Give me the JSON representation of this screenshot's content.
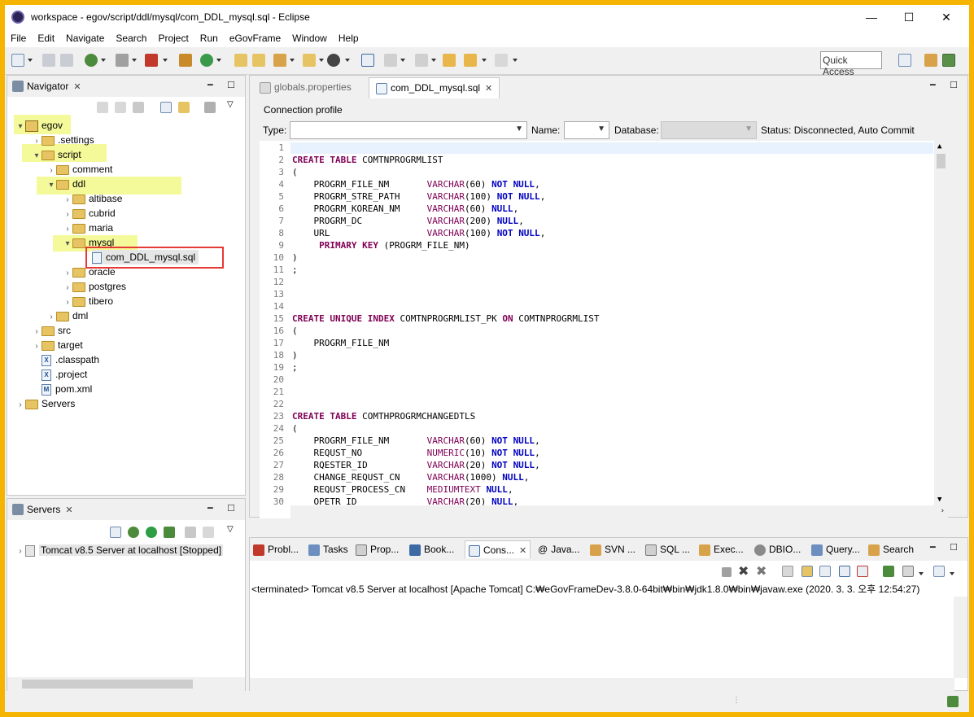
{
  "window": {
    "title": "workspace - egov/script/ddl/mysql/com_DDL_mysql.sql - Eclipse",
    "minimize": "—",
    "maximize": "☐",
    "close": "✕"
  },
  "menu": [
    "File",
    "Edit",
    "Navigate",
    "Search",
    "Project",
    "Run",
    "eGovFrame",
    "Window",
    "Help"
  ],
  "toolbar": {
    "quick_access": "Quick Access"
  },
  "navigator": {
    "title": "Navigator",
    "tree": [
      {
        "label": "egov",
        "twisty": "▾"
      },
      {
        "label": ".settings",
        "twisty": "›"
      },
      {
        "label": "script",
        "twisty": "▾"
      },
      {
        "label": "comment",
        "twisty": "›"
      },
      {
        "label": "ddl",
        "twisty": "▾"
      },
      {
        "label": "altibase",
        "twisty": "›"
      },
      {
        "label": "cubrid",
        "twisty": "›"
      },
      {
        "label": "maria",
        "twisty": "›"
      },
      {
        "label": "mysql",
        "twisty": "▾"
      },
      {
        "label": "com_DDL_mysql.sql",
        "twisty": ""
      },
      {
        "label": "oracle",
        "twisty": "›"
      },
      {
        "label": "postgres",
        "twisty": "›"
      },
      {
        "label": "tibero",
        "twisty": "›"
      },
      {
        "label": "dml",
        "twisty": "›"
      },
      {
        "label": "src",
        "twisty": "›"
      },
      {
        "label": "target",
        "twisty": "›"
      },
      {
        "label": ".classpath",
        "twisty": ""
      },
      {
        "label": ".project",
        "twisty": ""
      },
      {
        "label": "pom.xml",
        "twisty": ""
      },
      {
        "label": "Servers",
        "twisty": "›"
      }
    ]
  },
  "servers_view": {
    "title": "Servers",
    "item": "Tomcat v8.5 Server at localhost  [Stopped]"
  },
  "editor": {
    "tabs": [
      {
        "label": "globals.properties"
      },
      {
        "label": "com_DDL_mysql.sql"
      }
    ],
    "connection_profile": {
      "group_label": "Connection profile",
      "type_label": "Type:",
      "name_label": "Name:",
      "database_label": "Database:",
      "status": "Status: Disconnected, Auto Commit"
    },
    "lines": [
      "",
      "CREATE TABLE COMTNPROGRMLIST",
      "(",
      "    PROGRM_FILE_NM       VARCHAR(60) NOT NULL,",
      "    PROGRM_STRE_PATH     VARCHAR(100) NOT NULL,",
      "    PROGRM_KOREAN_NM     VARCHAR(60) NULL,",
      "    PROGRM_DC            VARCHAR(200) NULL,",
      "    URL                  VARCHAR(100) NOT NULL,",
      "     PRIMARY KEY (PROGRM_FILE_NM)",
      ")",
      ";",
      "",
      "",
      "",
      "CREATE UNIQUE INDEX COMTNPROGRMLIST_PK ON COMTNPROGRMLIST",
      "(",
      "    PROGRM_FILE_NM",
      ")",
      ";",
      "",
      "",
      "",
      "CREATE TABLE COMTHPROGRMCHANGEDTLS",
      "(",
      "    PROGRM_FILE_NM       VARCHAR(60) NOT NULL,",
      "    REQUST_NO            NUMERIC(10) NOT NULL,",
      "    RQESTER_ID           VARCHAR(20) NOT NULL,",
      "    CHANGE_REQUST_CN     VARCHAR(1000) NULL,",
      "    REQUST_PROCESS_CN    MEDIUMTEXT NULL,",
      "    OPETR_ID             VARCHAR(20) NULL,"
    ]
  },
  "bottom": {
    "tabs": [
      "Probl...",
      "Tasks",
      "Prop...",
      "Book...",
      "Cons...",
      "Java...",
      "SVN ...",
      "SQL ...",
      "Exec...",
      "DBIO...",
      "Query...",
      "Search"
    ],
    "console_line": "<terminated> Tomcat v8.5 Server at localhost [Apache Tomcat] C:₩eGovFrameDev-3.8.0-64bit₩bin₩jdk1.8.0₩bin₩javaw.exe (2020. 3. 3. 오후 12:54:27)"
  },
  "colors": {
    "frame_border": "#f5b400",
    "highlight": "#f4f99a",
    "annotation_box": "#e53935"
  }
}
